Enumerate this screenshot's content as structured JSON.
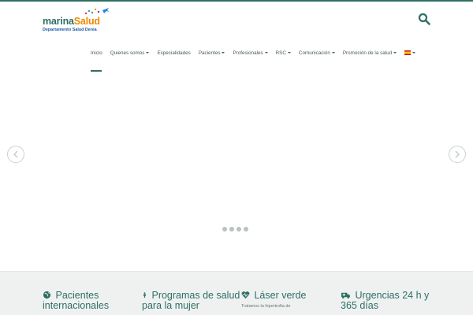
{
  "brand": {
    "logo_word_1": "marina",
    "logo_word_2": "Salud",
    "logo_sub": "Departamento Salud Denia"
  },
  "header": {
    "search_icon": "search-icon"
  },
  "nav": {
    "items": [
      {
        "label": "Inicio",
        "dropdown": false,
        "active": true
      },
      {
        "label": "Quienes somos",
        "dropdown": true
      },
      {
        "label": "Especialidades",
        "dropdown": false
      },
      {
        "label": "Pacientes",
        "dropdown": true
      },
      {
        "label": "Profesionales",
        "dropdown": true
      },
      {
        "label": "RSC",
        "dropdown": true
      },
      {
        "label": "Comunicación",
        "dropdown": true
      },
      {
        "label": "Promoción de la salud",
        "dropdown": true
      }
    ],
    "language_icon": "spain-flag-icon"
  },
  "slider": {
    "prev_icon": "chevron-left-icon",
    "next_icon": "chevron-right-icon",
    "slide_count": 4
  },
  "features": [
    {
      "icon": "globe-icon",
      "title_line1": "Pacientes",
      "title_line2": "internacionales",
      "desc": ""
    },
    {
      "icon": "female-icon",
      "title_line1": "Programas de salud",
      "title_line2": "para la mujer",
      "desc": ""
    },
    {
      "icon": "heartbeat-icon",
      "title_line1": "Láser verde",
      "title_line2": "",
      "desc": "Tratamos la hipertrofia de"
    },
    {
      "icon": "ambulance-icon",
      "title_line1": "Urgencias 24 h y",
      "title_line2": "365 días",
      "desc": ""
    }
  ],
  "colors": {
    "primary": "#2e6f63",
    "accent": "#f08a00",
    "nav_text": "#4a5a5a",
    "footer_bg": "#eff1f1"
  }
}
